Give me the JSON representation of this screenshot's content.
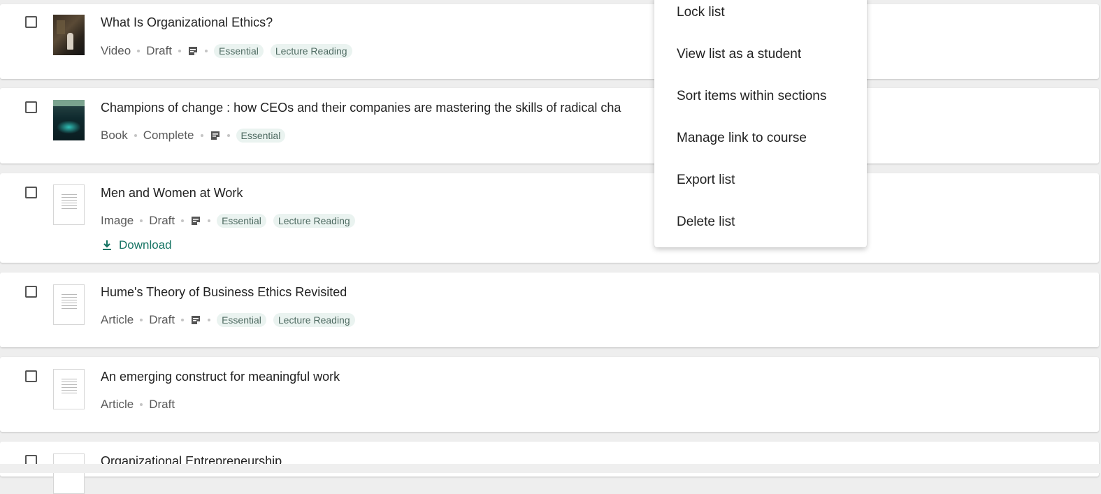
{
  "items": [
    {
      "title": "What Is Organizational Ethics?",
      "type": "Video",
      "status": "Draft",
      "has_note": true,
      "tags": [
        "Essential",
        "Lecture Reading"
      ],
      "thumbnail": "video-thumbnail"
    },
    {
      "title": "Champions of change : how CEOs and their companies are mastering the skills of radical cha",
      "type": "Book",
      "status": "Complete",
      "has_note": true,
      "tags": [
        "Essential"
      ],
      "thumbnail": "book-cover"
    },
    {
      "title": "Men and Women at Work",
      "type": "Image",
      "status": "Draft",
      "has_note": true,
      "tags": [
        "Essential",
        "Lecture Reading"
      ],
      "thumbnail": "document-icon",
      "download_label": "Download"
    },
    {
      "title": "Hume's Theory of Business Ethics Revisited",
      "type": "Article",
      "status": "Draft",
      "has_note": true,
      "tags": [
        "Essential",
        "Lecture Reading"
      ],
      "thumbnail": "document-icon"
    },
    {
      "title": "An emerging construct for meaningful work",
      "type": "Article",
      "status": "Draft",
      "has_note": false,
      "tags": [],
      "thumbnail": "document-icon"
    },
    {
      "title": "Organizational Entrepreneurship",
      "thumbnail": "document-icon"
    }
  ],
  "menu": {
    "items": [
      "Lock list",
      "View list as a student",
      "Sort items within sections",
      "Manage link to course",
      "Export list",
      "Delete list"
    ]
  },
  "icons": {
    "note": "note-icon",
    "download": "download-icon"
  },
  "colors": {
    "accent": "#177464",
    "tag_bg": "#eaf3f0",
    "tag_text": "#4f6b62"
  }
}
